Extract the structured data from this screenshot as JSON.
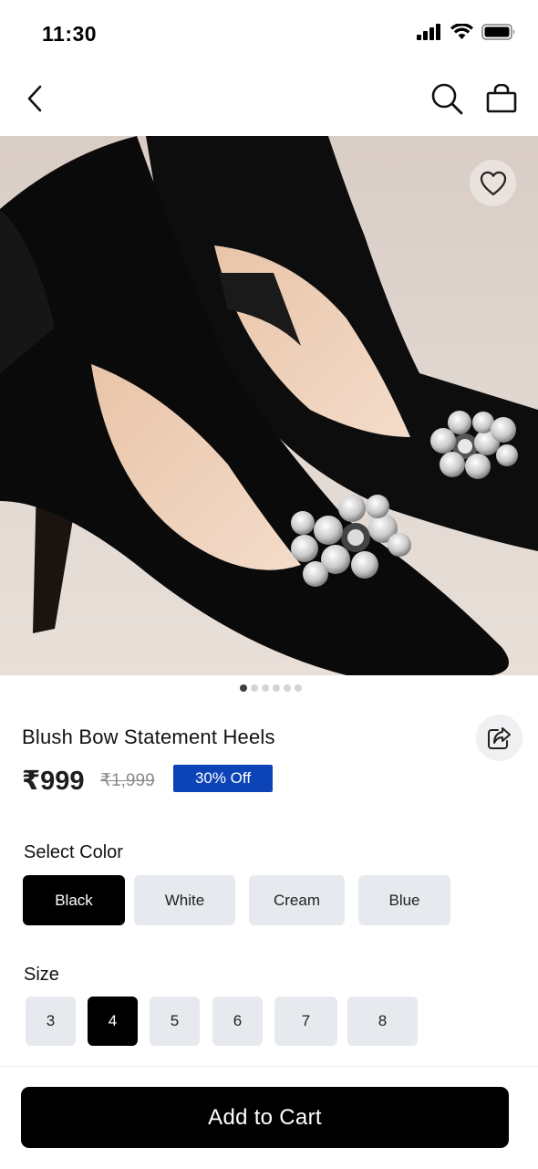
{
  "status_bar": {
    "time": "11:30",
    "icons": [
      "cellular-signal-icon",
      "wifi-icon",
      "battery-icon"
    ]
  },
  "nav": {
    "icons": [
      "chevron-left-icon",
      "search-icon",
      "shopping-bag-icon"
    ]
  },
  "gallery": {
    "image_count": 6,
    "active_index": 0,
    "favorite_icon": "heart-outline-icon"
  },
  "product": {
    "title": "Blush Bow Statement Heels",
    "price": "₹999",
    "original_price": "₹1,999",
    "discount": "30% Off",
    "share_icon": "share-icon"
  },
  "colors": {
    "label": "Select Color",
    "options": [
      "Black",
      "White",
      "Cream",
      "Blue"
    ],
    "selected": "Black"
  },
  "sizes": {
    "label": "Size",
    "options": [
      "3",
      "4",
      "5",
      "6",
      "7",
      "8"
    ],
    "selected": "4"
  },
  "cart": {
    "label": "Add to Cart"
  },
  "theme": {
    "accent": "#0c44b8",
    "selected_bg": "#000000",
    "chip_bg": "#e6e9ee"
  }
}
